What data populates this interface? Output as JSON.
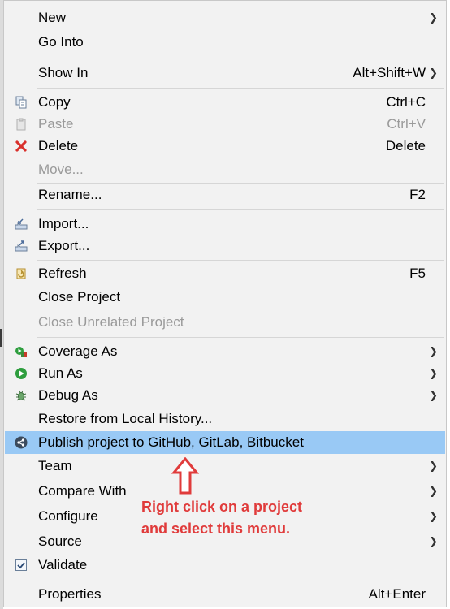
{
  "menu": {
    "items": [
      {
        "label": "New",
        "submenu": true
      },
      {
        "label": "Go Into"
      },
      {
        "label": "Show In",
        "shortcut": "Alt+Shift+W",
        "submenu": true
      },
      {
        "label": "Copy",
        "shortcut": "Ctrl+C",
        "icon": "copy-icon"
      },
      {
        "label": "Paste",
        "shortcut": "Ctrl+V",
        "icon": "paste-icon",
        "disabled": true
      },
      {
        "label": "Delete",
        "shortcut": "Delete",
        "icon": "delete-icon"
      },
      {
        "label": "Move...",
        "disabled": true
      },
      {
        "label": "Rename...",
        "shortcut": "F2"
      },
      {
        "label": "Import...",
        "icon": "import-icon"
      },
      {
        "label": "Export...",
        "icon": "export-icon"
      },
      {
        "label": "Refresh",
        "shortcut": "F5",
        "icon": "refresh-icon"
      },
      {
        "label": "Close Project"
      },
      {
        "label": "Close Unrelated Project",
        "disabled": true
      },
      {
        "label": "Coverage As",
        "icon": "coverage-icon",
        "submenu": true
      },
      {
        "label": "Run As",
        "icon": "run-icon",
        "submenu": true
      },
      {
        "label": "Debug As",
        "icon": "debug-icon",
        "submenu": true
      },
      {
        "label": "Restore from Local History..."
      },
      {
        "label": "Publish project to GitHub, GitLab, Bitbucket",
        "icon": "share-icon",
        "highlighted": true
      },
      {
        "label": "Team",
        "submenu": true
      },
      {
        "label": "Compare With",
        "submenu": true
      },
      {
        "label": "Configure",
        "submenu": true
      },
      {
        "label": "Source",
        "submenu": true
      },
      {
        "label": "Validate",
        "icon": "checkbox-icon"
      },
      {
        "label": "Properties",
        "shortcut": "Alt+Enter"
      }
    ]
  },
  "annotation": {
    "line1": "Right click on a project",
    "line2": "and select this menu.",
    "color": "#e03b3b"
  },
  "colors": {
    "highlight": "#99c9f5",
    "menu_bg": "#f2f2f2",
    "disabled_text": "#9a9a9a"
  }
}
